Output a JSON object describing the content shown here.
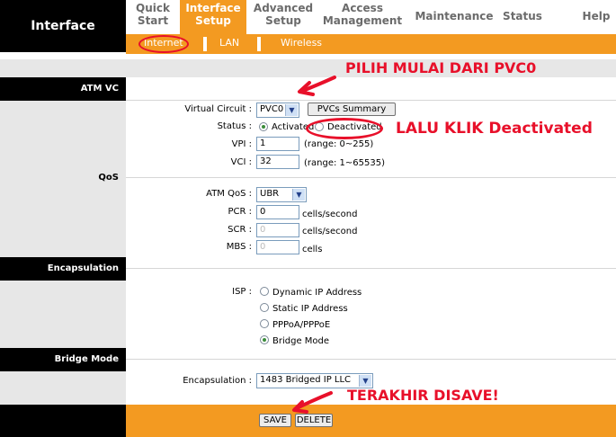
{
  "header": {
    "logo": "Interface",
    "nav": [
      {
        "line1": "Quick",
        "line2": "Start"
      },
      {
        "line1": "Interface",
        "line2": "Setup"
      },
      {
        "line1": "Advanced",
        "line2": "Setup"
      },
      {
        "line1": "Access",
        "line2": "Management"
      },
      {
        "line1": "Maintenance",
        "line2": ""
      },
      {
        "line1": "Status",
        "line2": ""
      },
      {
        "line1": "Help",
        "line2": ""
      }
    ],
    "subnav": [
      "Internet",
      "LAN",
      "Wireless"
    ]
  },
  "sections": {
    "atm_vc": "ATM VC",
    "qos": "QoS",
    "encapsulation": "Encapsulation",
    "bridge_mode": "Bridge Mode"
  },
  "atm": {
    "virtual_circuit_label": "Virtual Circuit :",
    "virtual_circuit_value": "PVC0",
    "pvcs_summary_button": "PVCs Summary",
    "status_label": "Status :",
    "status_activated": "Activated",
    "status_deactivated": "Deactivated",
    "vpi_label": "VPI :",
    "vpi_value": "1",
    "vpi_range": "(range: 0~255)",
    "vci_label": "VCI :",
    "vci_value": "32",
    "vci_range": "(range: 1~65535)"
  },
  "qos": {
    "atm_qos_label": "ATM QoS :",
    "atm_qos_value": "UBR",
    "pcr_label": "PCR :",
    "pcr_value": "0",
    "pcr_unit": "cells/second",
    "scr_label": "SCR :",
    "scr_value": "0",
    "scr_unit": "cells/second",
    "mbs_label": "MBS :",
    "mbs_value": "0",
    "mbs_unit": "cells"
  },
  "encap": {
    "isp_label": "ISP :",
    "options": [
      "Dynamic IP Address",
      "Static IP Address",
      "PPPoA/PPPoE",
      "Bridge Mode"
    ],
    "selected": "Bridge Mode"
  },
  "bridge": {
    "encapsulation_label": "Encapsulation :",
    "encapsulation_value": "1483 Bridged IP LLC"
  },
  "footer": {
    "save_button": "SAVE",
    "delete_button": "DELETE"
  },
  "annotations": {
    "note1": "PILIH MULAI DARI PVC0",
    "note2": "LALU KLIK Deactivated",
    "note3": "TERAKHIR DISAVE!"
  },
  "colors": {
    "accent_orange": "#f39a21",
    "annotation_red": "#e8102a"
  }
}
